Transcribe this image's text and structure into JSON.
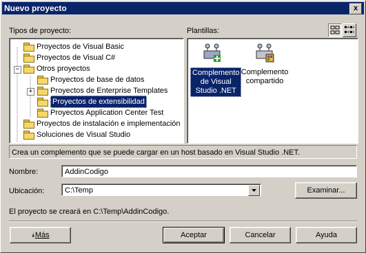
{
  "window": {
    "title": "Nuevo proyecto",
    "close_label": "x"
  },
  "labels": {
    "project_types": "Tipos de proyecto:",
    "templates": "Plantillas:",
    "name": "Nombre:",
    "location": "Ubicación:"
  },
  "tree": [
    {
      "label": "Proyectos de Visual Basic",
      "level": 1
    },
    {
      "label": "Proyectos de Visual C#",
      "level": 1
    },
    {
      "label": "Otros proyectos",
      "level": 1,
      "expander": "−"
    },
    {
      "label": "Proyectos de base de datos",
      "level": 2
    },
    {
      "label": "Proyectos de Enterprise Templates",
      "level": 2,
      "expander": "+"
    },
    {
      "label": "Proyectos de extensibilidad",
      "level": 2,
      "selected": true
    },
    {
      "label": "Proyectos Application Center Test",
      "level": 2
    },
    {
      "label": "Proyectos de instalación e implementación",
      "level": 1
    },
    {
      "label": "Soluciones de Visual Studio",
      "level": 1
    }
  ],
  "templates": [
    {
      "label": "Complemento de Visual Studio .NET",
      "selected": true,
      "icon": "addin-vsnet-icon"
    },
    {
      "label": "Complemento compartido",
      "selected": false,
      "icon": "shared-addin-icon"
    }
  ],
  "description": "Crea un complemento que se puede cargar en un host basado en Visual Studio .NET.",
  "fields": {
    "name_value": "AddinCodigo",
    "location_value": "C:\\Temp"
  },
  "status_text": "El proyecto se creará en C:\\Temp\\AddinCodigo.",
  "buttons": {
    "browse": "Examinar...",
    "more": "Más",
    "more_arrow": "⯯",
    "accept": "Aceptar",
    "cancel": "Cancelar",
    "help": "Ayuda"
  },
  "colors": {
    "title_bar": "#0a246a",
    "dialog_bg": "#d4d0c8",
    "selection": "#0a246a"
  }
}
